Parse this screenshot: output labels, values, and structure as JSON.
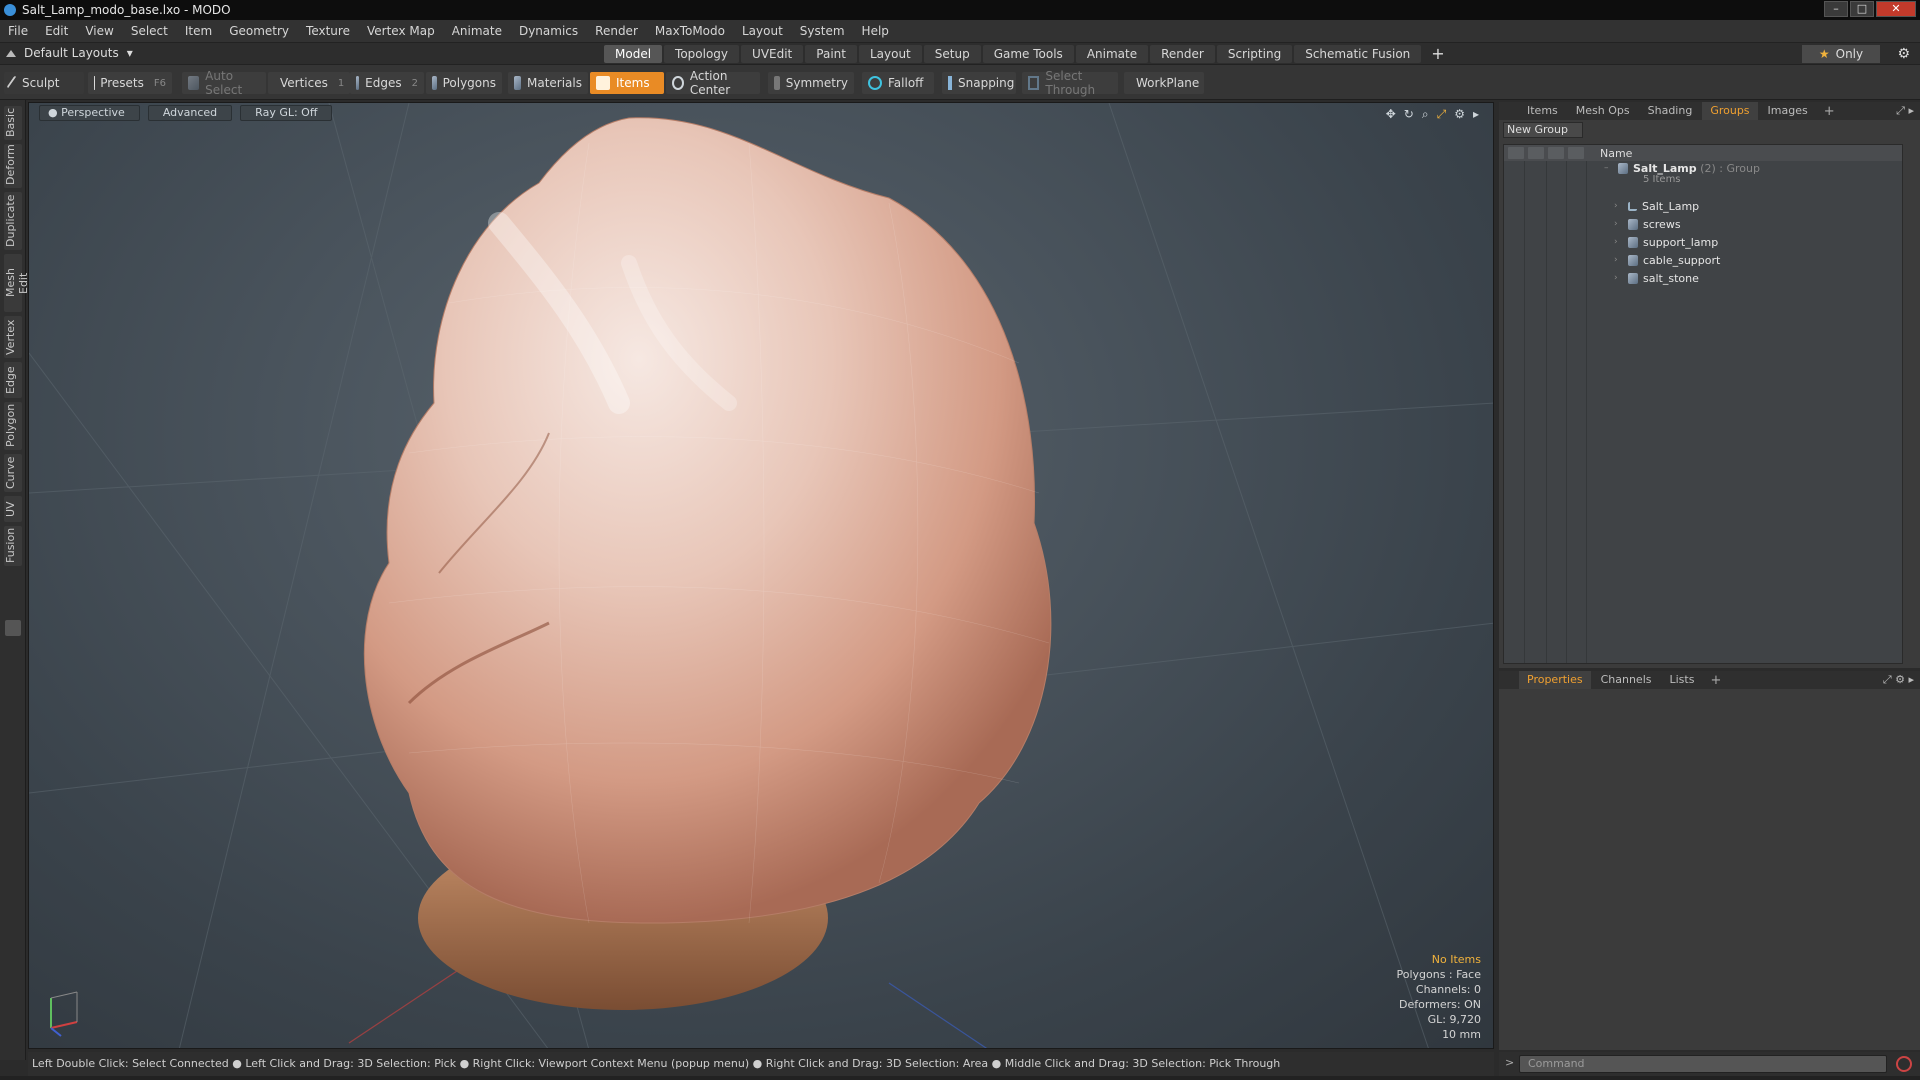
{
  "window": {
    "title": "Salt_Lamp_modo_base.lxo - MODO"
  },
  "menu": [
    "File",
    "Edit",
    "View",
    "Select",
    "Item",
    "Geometry",
    "Texture",
    "Vertex Map",
    "Animate",
    "Dynamics",
    "Render",
    "MaxToModo",
    "Layout",
    "System",
    "Help"
  ],
  "layout_bar": {
    "layout_selector": "Default Layouts",
    "tabs": [
      "Model",
      "Topology",
      "UVEdit",
      "Paint",
      "Layout",
      "Setup",
      "Game Tools",
      "Animate",
      "Render",
      "Scripting",
      "Schematic Fusion"
    ],
    "active_tab": "Model",
    "only_label": "Only"
  },
  "toolbar": {
    "sculpt": "Sculpt",
    "presets": "Presets",
    "presets_key": "F6",
    "auto_select": "Auto Select",
    "vertices": "Vertices",
    "vertices_key": "1",
    "edges": "Edges",
    "edges_key": "2",
    "polygons": "Polygons",
    "materials": "Materials",
    "items": "Items",
    "action_center": "Action Center",
    "symmetry": "Symmetry",
    "falloff": "Falloff",
    "snapping": "Snapping",
    "select_through": "Select Through",
    "workplane": "WorkPlane"
  },
  "left_tabs": [
    "Basic",
    "Deform",
    "Duplicate",
    "Mesh Edit",
    "Vertex",
    "Edge",
    "Polygon",
    "Curve",
    "UV",
    "Fusion"
  ],
  "viewport": {
    "view_mode": "Perspective",
    "shading": "Advanced",
    "raygl": "Ray GL: Off",
    "stats": {
      "selection": "No Items",
      "polygons": "Polygons : Face",
      "channels": "Channels: 0",
      "deformers": "Deformers: ON",
      "gl": "GL: 9,720",
      "scale": "10 mm"
    }
  },
  "status_bar": "Left Double Click: Select Connected ● Left Click and Drag: 3D Selection: Pick ● Right Click: Viewport Context Menu (popup menu) ● Right Click and Drag: 3D Selection: Area ● Middle Click and Drag: 3D Selection: Pick Through",
  "groups_panel": {
    "tabs": [
      "Items",
      "Mesh Ops",
      "Shading",
      "Groups",
      "Images"
    ],
    "active_tab": "Groups",
    "new_group": "New Group",
    "name_header": "Name",
    "group": {
      "name": "Salt_Lamp",
      "count": "(2)",
      "type": ": Group",
      "items_label": "5 Items"
    },
    "items": [
      "Salt_Lamp",
      "screws",
      "support_lamp",
      "cable_support",
      "salt_stone"
    ]
  },
  "properties_panel": {
    "tabs": [
      "Properties",
      "Channels",
      "Lists"
    ],
    "active_tab": "Properties"
  },
  "command": {
    "placeholder": "Command"
  },
  "colors": {
    "accent": "#e98b25",
    "highlight_text": "#f0b23c"
  }
}
